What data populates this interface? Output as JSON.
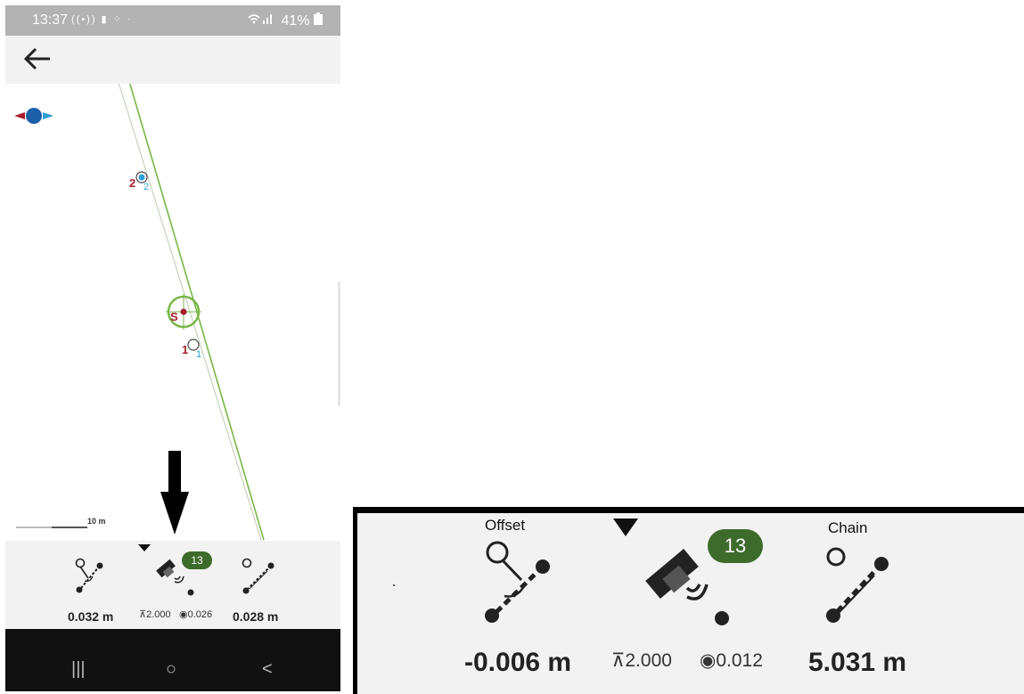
{
  "status_bar": {
    "time": "13:37",
    "left_icons": "((•)) ▮ ⁘ ·",
    "right_text": "41%"
  },
  "map": {
    "points": [
      {
        "name": "2",
        "label": "2"
      },
      {
        "name": "S",
        "label": "S"
      },
      {
        "name": "1",
        "label": "1"
      }
    ],
    "scale_label": "10 m",
    "line_color": "#7ab648",
    "point_color": "#a51f2c"
  },
  "bottom_panel": {
    "offset_value": "0.032 m",
    "satellite_count": "13",
    "height_value": "2.000",
    "accuracy_value": "0.026",
    "chain_value": "0.028 m",
    "badge_color": "#3d6b2b"
  },
  "zoom_panel": {
    "offset_label": "Offset",
    "chain_label": "Chain",
    "offset_value": "-0.006 m",
    "satellite_count": "13",
    "height_value": "2.000",
    "accuracy_value": "0.012",
    "chain_value": "5.031 m"
  },
  "navbar": {
    "recents_glyph": "|||",
    "home_glyph": "○",
    "back_glyph": "<"
  }
}
